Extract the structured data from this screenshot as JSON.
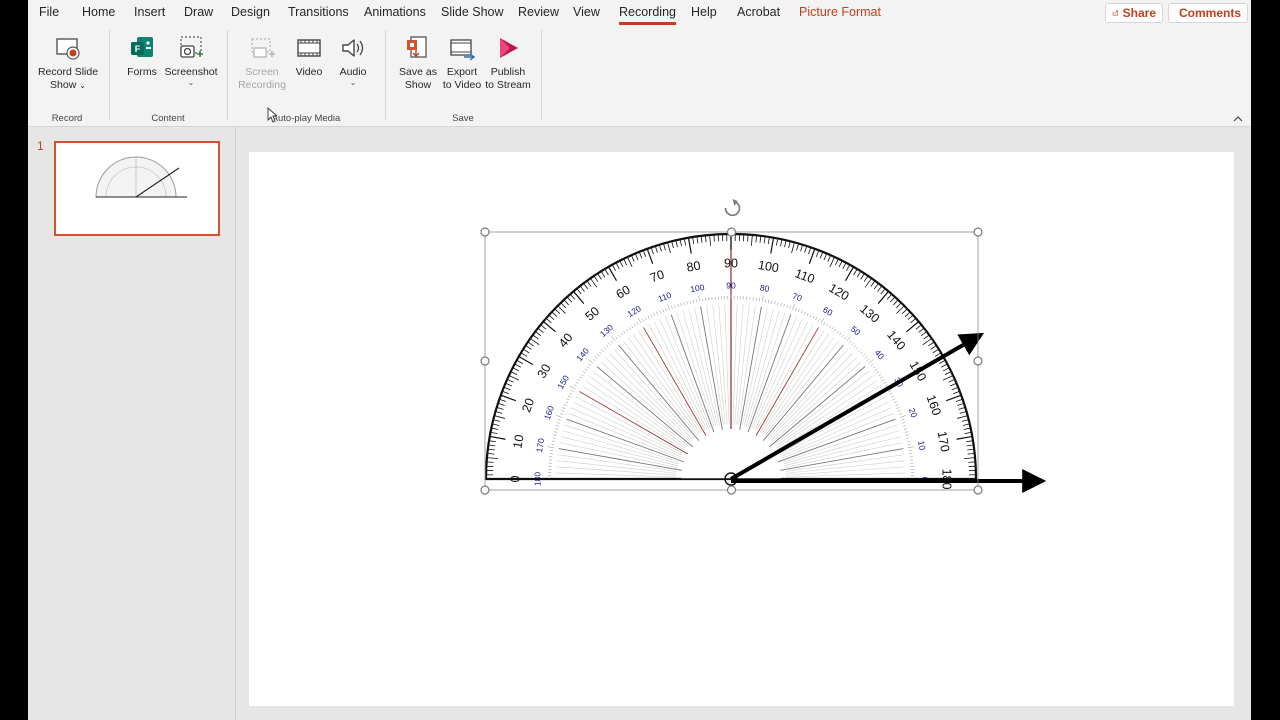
{
  "menu": {
    "tabs": [
      "File",
      "Home",
      "Insert",
      "Draw",
      "Design",
      "Transitions",
      "Animations",
      "Slide Show",
      "Review",
      "View",
      "Recording",
      "Help",
      "Acrobat",
      "Picture Format"
    ],
    "active_tab": "Recording",
    "share_label": "Share",
    "comments_label": "Comments"
  },
  "ribbon": {
    "record_slide_show": "Record Slide",
    "record_slide_show_2": "Show",
    "forms": "Forms",
    "screenshot": "Screenshot",
    "screen_recording": "Screen",
    "screen_recording_2": "Recording",
    "video": "Video",
    "audio": "Audio",
    "save_as_show": "Save as",
    "save_as_show_2": "Show",
    "export_to_video": "Export",
    "export_to_video_2": "to Video",
    "publish_to_stream": "Publish",
    "publish_to_stream_2": "to Stream",
    "groups": {
      "record": "Record",
      "content": "Content",
      "autoplay": "Auto-play Media",
      "save": "Save"
    }
  },
  "thumbnails": {
    "slide_number": "1"
  },
  "protractor": {
    "outer_labels": [
      "0",
      "10",
      "20",
      "30",
      "40",
      "50",
      "60",
      "70",
      "80",
      "90",
      "100",
      "110",
      "120",
      "130",
      "140",
      "150",
      "160",
      "170",
      "180"
    ],
    "inner_labels": [
      "180",
      "170",
      "160",
      "150",
      "140",
      "130",
      "120",
      "110",
      "100",
      "90",
      "80",
      "70",
      "60",
      "50",
      "40",
      "30",
      "20",
      "10",
      "0"
    ],
    "angle_ray_degrees": 30
  },
  "colors": {
    "accent": "#c43e1c",
    "inner_scale": "#1a1a8c"
  }
}
